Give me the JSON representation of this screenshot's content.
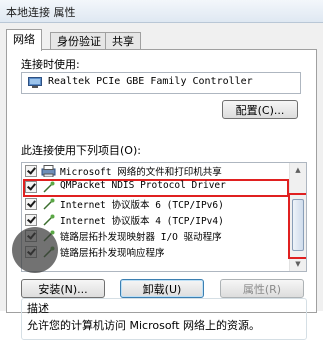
{
  "window": {
    "title": "本地连接 属性"
  },
  "tabs": [
    {
      "label": "网络",
      "active": true
    },
    {
      "label": "身份验证",
      "active": false
    },
    {
      "label": "共享",
      "active": false
    }
  ],
  "connect_using": {
    "label": "连接时使用:",
    "adapter": "Realtek PCIe GBE Family Controller",
    "configure_button": "配置(C)..."
  },
  "items_section": {
    "label": "此连接使用下列项目(O):",
    "items": [
      {
        "label": "Microsoft 网络的文件和打印机共享",
        "checked": true,
        "icon": "printer-share-icon"
      },
      {
        "label": "QMPacket NDIS Protocol Driver",
        "checked": true,
        "icon": "protocol-icon",
        "highlighted": true
      },
      {
        "label": "Internet 协议版本 6 (TCP/IPv6)",
        "checked": true,
        "icon": "protocol-icon"
      },
      {
        "label": "Internet 协议版本 4 (TCP/IPv4)",
        "checked": true,
        "icon": "protocol-icon"
      },
      {
        "label": "链路层拓扑发现映射器 I/O 驱动程序",
        "checked": true,
        "icon": "protocol-icon"
      },
      {
        "label": "链路层拓扑发现响应程序",
        "checked": true,
        "icon": "protocol-icon"
      }
    ]
  },
  "buttons": {
    "install": "安装(N)...",
    "uninstall": "卸载(U)",
    "properties": "属性(R)"
  },
  "description": {
    "label": "描述",
    "text": "允许您的计算机访问 Microsoft 网络上的资源。"
  },
  "colors": {
    "annotation_red": "#e02020",
    "panel_bg": "#f0f0f0",
    "title_bar": "#dfe8f2"
  }
}
